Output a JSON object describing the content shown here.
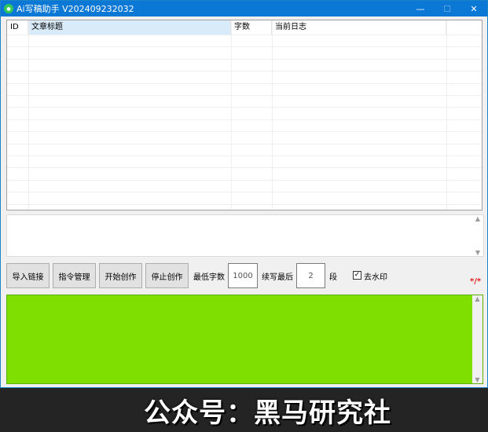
{
  "window": {
    "title": "Ai写稿助手 V202409232032",
    "minimize_glyph": "—",
    "maximize_glyph": "☐",
    "close_glyph": "✕"
  },
  "table": {
    "columns": [
      "ID",
      "文章标题",
      "字数",
      "当前日志"
    ],
    "rows": []
  },
  "log_box": {
    "value": ""
  },
  "controls": {
    "import_label": "导入链接",
    "prompt_label": "指令管理",
    "start_label": "开始创作",
    "stop_label": "停止创作",
    "min_words_label": "最低字数",
    "min_words_value": "1000",
    "continue_label": "续写最后",
    "continue_value": "2",
    "segment_unit": "段",
    "watermark_label": "去水印",
    "watermark_checked": true,
    "red_marker": "*/*"
  },
  "output_box": {
    "value": "",
    "color": "#7fe000"
  },
  "banner": {
    "text": "公众号：黑马研究社"
  }
}
